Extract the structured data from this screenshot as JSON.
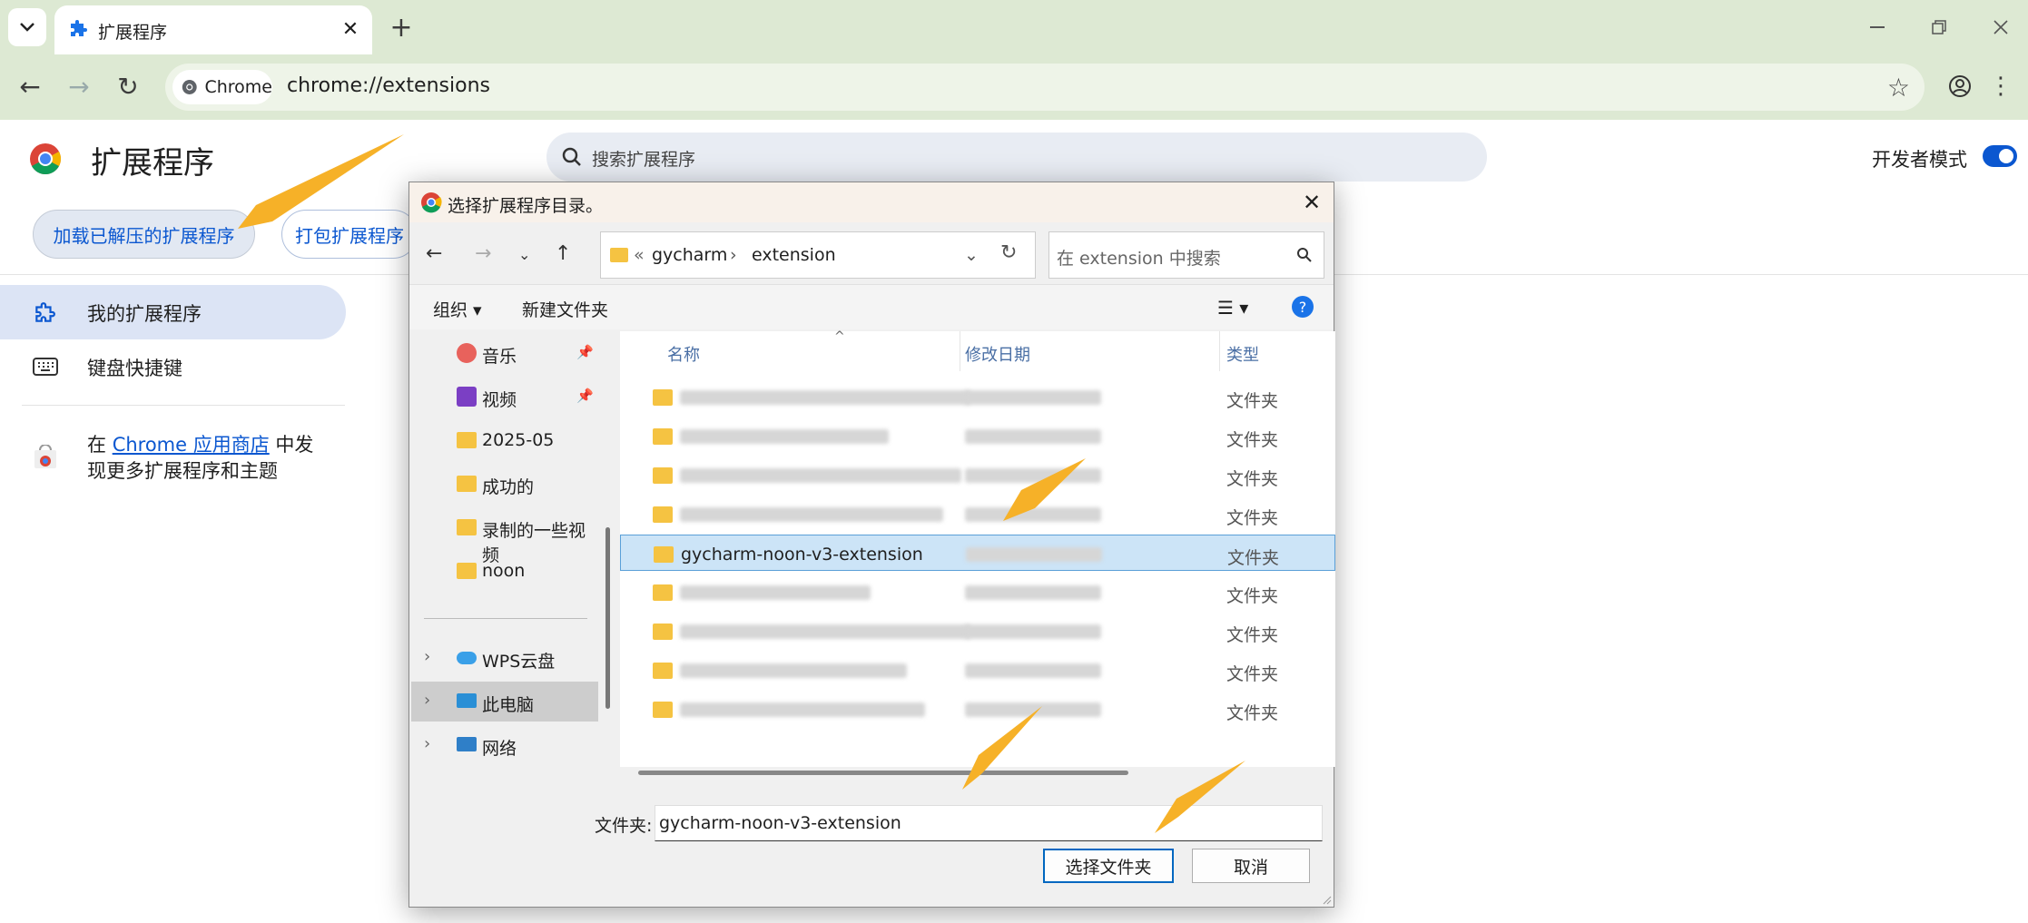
{
  "browser": {
    "tab_title": "扩展程序",
    "chip_label": "Chrome",
    "url": "chrome://extensions"
  },
  "page": {
    "title": "扩展程序",
    "search_placeholder": "搜索扩展程序",
    "dev_mode_label": "开发者模式",
    "dev_mode_on": true,
    "load_unpacked": "加载已解压的扩展程序",
    "pack_extension": "打包扩展程序",
    "sidebar": [
      {
        "label": "我的扩展程序",
        "active": true
      },
      {
        "label": "键盘快捷键",
        "active": false
      }
    ],
    "store_prefix": "在 ",
    "store_link": "Chrome 应用商店",
    "store_suffix": " 中发现更多扩展程序和主题"
  },
  "dialog": {
    "title": "选择扩展程序目录。",
    "path": [
      "gycharm",
      "extension"
    ],
    "search_placeholder": "在 extension 中搜索",
    "organize": "组织",
    "new_folder": "新建文件夹",
    "nav_items": [
      {
        "label": "音乐",
        "icon": "music-icon",
        "pinned": true
      },
      {
        "label": "视频",
        "icon": "video-icon",
        "pinned": true
      },
      {
        "label": "2025-05",
        "icon": "folder-icon",
        "pinned": false
      },
      {
        "label": "成功的",
        "icon": "folder-icon",
        "pinned": false
      },
      {
        "label": "录制的一些视频",
        "icon": "folder-icon",
        "pinned": false
      },
      {
        "label": "noon",
        "icon": "folder-icon",
        "pinned": false
      },
      {
        "label": "WPS云盘",
        "icon": "cloud-icon",
        "pinned": false
      },
      {
        "label": "此电脑",
        "icon": "computer-icon",
        "pinned": false
      },
      {
        "label": "网络",
        "icon": "network-icon",
        "pinned": false
      }
    ],
    "columns": {
      "name": "名称",
      "date": "修改日期",
      "type": "类型"
    },
    "files": [
      {
        "name": "",
        "type": "文件夹",
        "selected": false
      },
      {
        "name": "",
        "type": "文件夹",
        "selected": false
      },
      {
        "name": "",
        "type": "文件夹",
        "selected": false
      },
      {
        "name": "",
        "type": "文件夹",
        "selected": false
      },
      {
        "name": "gycharm-noon-v3-extension",
        "type": "文件夹",
        "selected": true
      },
      {
        "name": "",
        "type": "文件夹",
        "selected": false
      },
      {
        "name": "",
        "type": "文件夹",
        "selected": false
      },
      {
        "name": "",
        "type": "文件夹",
        "selected": false
      },
      {
        "name": "",
        "type": "文件夹",
        "selected": false
      }
    ],
    "folder_label": "文件夹:",
    "folder_value": "gycharm-noon-v3-extension",
    "select_button": "选择文件夹",
    "cancel_button": "取消"
  },
  "colors": {
    "accent": "#0b57d0",
    "arrow": "#f6b128",
    "frame": "#dde9d3"
  }
}
